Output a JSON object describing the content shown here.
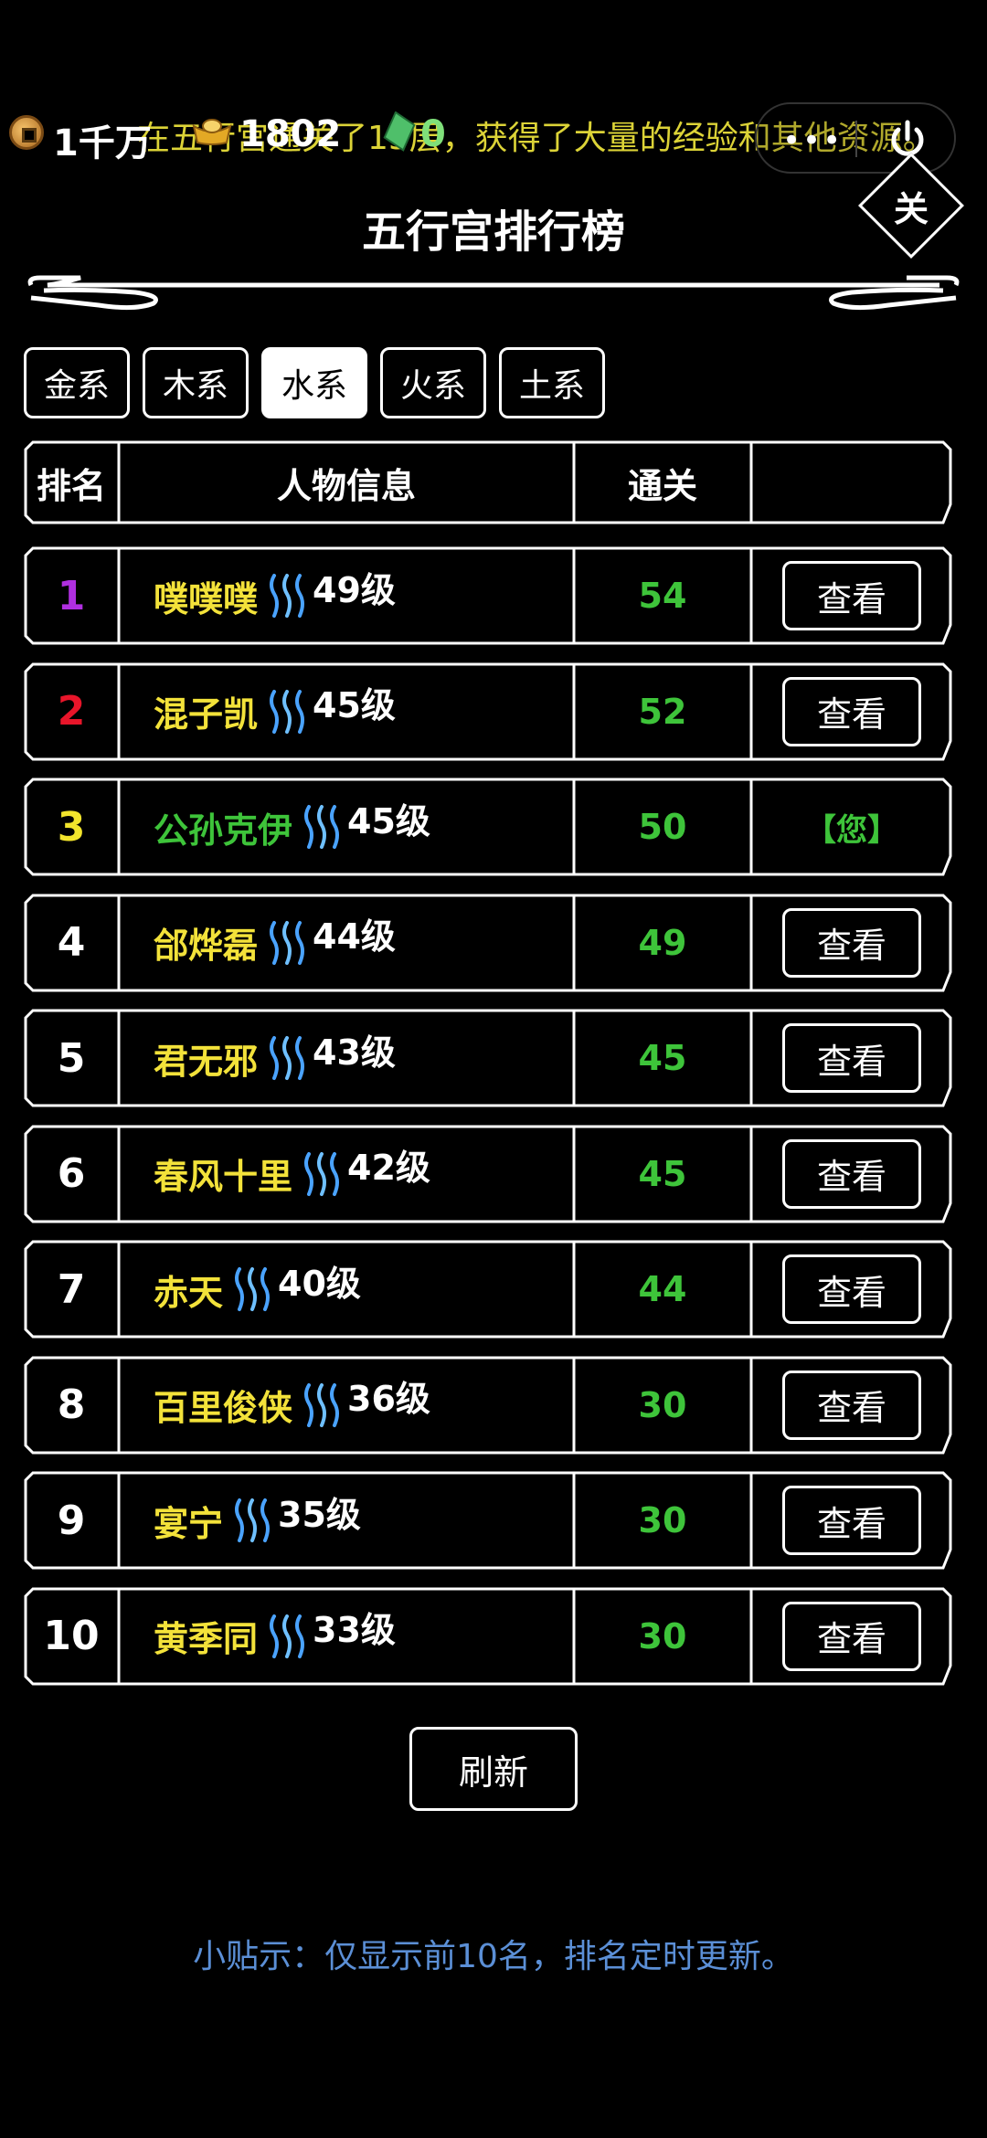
{
  "topbar": {
    "coins": "1千万",
    "ingots": "1802",
    "jade": "0",
    "marquee": "在五行宫通关了15层，获得了大量的经验和其他资源。",
    "menu_dots": "•••"
  },
  "header": {
    "title": "五行宫排行榜",
    "close_label": "关"
  },
  "tabs": [
    {
      "label": "金系",
      "active": false
    },
    {
      "label": "木系",
      "active": false
    },
    {
      "label": "水系",
      "active": true
    },
    {
      "label": "火系",
      "active": false
    },
    {
      "label": "土系",
      "active": false
    }
  ],
  "table": {
    "columns": [
      "排名",
      "人物信息",
      "通关",
      ""
    ],
    "rows": [
      {
        "rank": "1",
        "rank_color": "#b02fe0",
        "name": "噗噗噗",
        "level": "49级",
        "passed": "54",
        "action": "查看",
        "is_self": false
      },
      {
        "rank": "2",
        "rank_color": "#e8152a",
        "name": "混子凯",
        "level": "45级",
        "passed": "52",
        "action": "查看",
        "is_self": false
      },
      {
        "rank": "3",
        "rank_color": "#f2e42c",
        "name": "公孙克伊",
        "level": "45级",
        "passed": "50",
        "action": "【您】",
        "is_self": true
      },
      {
        "rank": "4",
        "rank_color": "#ffffff",
        "name": "郃烨磊",
        "level": "44级",
        "passed": "49",
        "action": "查看",
        "is_self": false
      },
      {
        "rank": "5",
        "rank_color": "#ffffff",
        "name": "君无邪",
        "level": "43级",
        "passed": "45",
        "action": "查看",
        "is_self": false
      },
      {
        "rank": "6",
        "rank_color": "#ffffff",
        "name": "春风十里",
        "level": "42级",
        "passed": "45",
        "action": "查看",
        "is_self": false
      },
      {
        "rank": "7",
        "rank_color": "#ffffff",
        "name": "赤天",
        "level": "40级",
        "passed": "44",
        "action": "查看",
        "is_self": false
      },
      {
        "rank": "8",
        "rank_color": "#ffffff",
        "name": "百里俊侠",
        "level": "36级",
        "passed": "30",
        "action": "查看",
        "is_self": false
      },
      {
        "rank": "9",
        "rank_color": "#ffffff",
        "name": "宴宁",
        "level": "35级",
        "passed": "30",
        "action": "查看",
        "is_self": false
      },
      {
        "rank": "10",
        "rank_color": "#ffffff",
        "name": "黄季同",
        "level": "33级",
        "passed": "30",
        "action": "查看",
        "is_self": false
      }
    ]
  },
  "refresh_label": "刷新",
  "tip": "小贴示：仅显示前10名，排名定时更新。",
  "icons": {
    "coin": "coin-icon",
    "ingot": "gold-ingot-icon",
    "jade": "jade-icon",
    "power": "power-icon",
    "water": "water-element-icon"
  },
  "colors": {
    "name": "#f3e23a",
    "self_name": "#3ec43a",
    "pass": "#3ec43a",
    "tip": "#5b8fd6",
    "marquee": "#e8df3a"
  }
}
